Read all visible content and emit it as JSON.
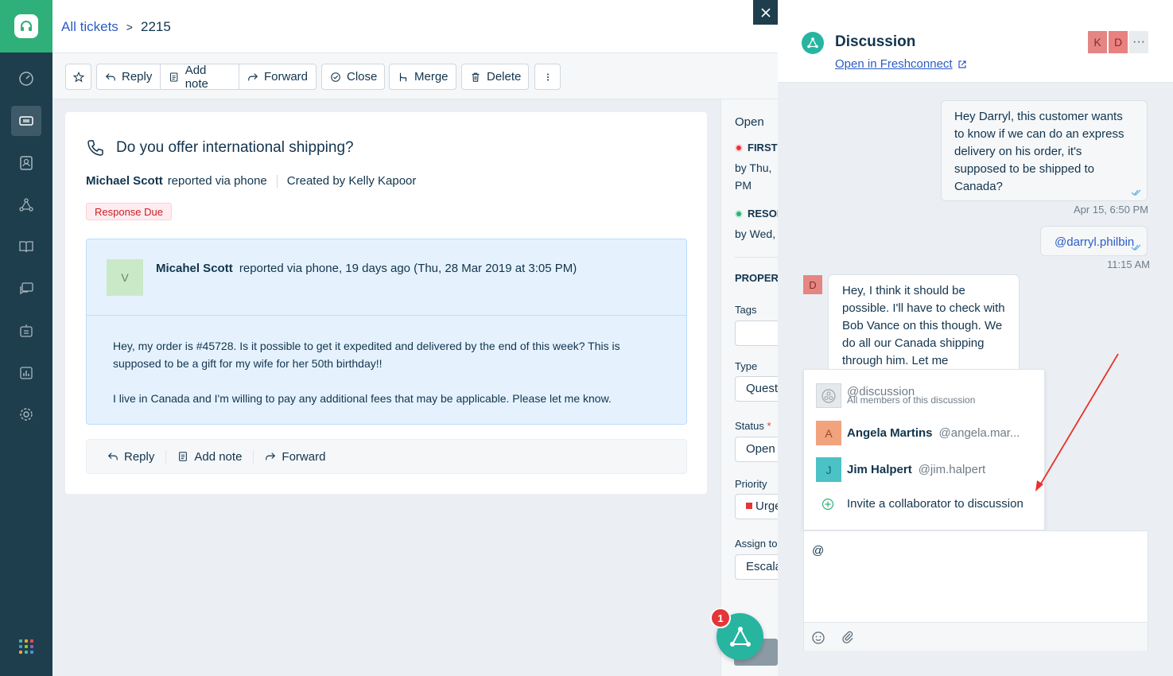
{
  "breadcrumb": {
    "all_tickets": "All tickets",
    "separator": ">",
    "ticket_id": "2215"
  },
  "toolbar": {
    "reply": "Reply",
    "add_note": "Add note",
    "forward": "Forward",
    "close": "Close",
    "merge": "Merge",
    "delete": "Delete"
  },
  "ticket": {
    "subject": "Do you offer international shipping?",
    "requester": "Michael Scott",
    "via": "reported via phone",
    "created_by": "Created by Kelly Kapoor",
    "badge": "Response Due"
  },
  "message": {
    "avatar_initial": "V",
    "from": "Micahel Scott",
    "from_meta": "reported via phone, 19 days ago (Thu, 28 Mar 2019 at 3:05 PM)",
    "paragraph1": "Hey, my order is #45728. Is it possible to get it expedited and delivered by the end of this week? This is supposed to be a gift for my wife for her 50th birthday!!",
    "paragraph2": "I live in Canada and I'm willing to pay any additional fees that may be applicable. Please let me know."
  },
  "message_actions": {
    "reply": "Reply",
    "add_note": "Add note",
    "forward": "Forward"
  },
  "properties": {
    "status_heading": "Open",
    "first_label": "FIRST",
    "first_by": "by Thu,",
    "first_time": "PM",
    "resol_label": "RESOL",
    "resol_by": "by Wed,",
    "section": "PROPERT",
    "tags_label": "Tags",
    "type_label": "Type",
    "type_value": "Quest",
    "status_label": "Status",
    "status_value": "Open",
    "priority_label": "Priority",
    "priority_value": "Urge",
    "assign_label": "Assign to",
    "assign_value": "Escala"
  },
  "discussion": {
    "title": "Discussion",
    "open_link": "Open in Freshconnect",
    "avatars": [
      "K",
      "D"
    ],
    "more": "···",
    "messages": [
      {
        "text": "Hey Darryl, this customer wants to know if we can do an express delivery on his order, it's supposed to be shipped to Canada?",
        "time": "Apr 15, 6:50 PM"
      },
      {
        "text": "@darryl.philbin",
        "time": "11:15 AM"
      },
      {
        "avatar": "D",
        "text": "Hey, I think it should be possible. I'll have to check with Bob Vance on this though. We do all our Canada shipping through him. Let me"
      }
    ],
    "mention_menu": [
      {
        "name": "@discussion",
        "handle": "All members of this discussion"
      },
      {
        "initial": "A",
        "name": "Angela Martins",
        "handle": "@angela.mar..."
      },
      {
        "initial": "J",
        "name": "Jim Halpert",
        "handle": "@jim.halpert"
      },
      {
        "name": "Invite a collaborator to discussion"
      }
    ],
    "compose_value": "@"
  },
  "fab_badge": "1",
  "colors": {
    "brand_green": "#2fb07a",
    "nav_dark": "#1f3e4d",
    "link_blue": "#2c5cc5",
    "teal": "#27b5a0",
    "badge_red": "#e43538",
    "annotation_arrow": "#e8322b"
  }
}
